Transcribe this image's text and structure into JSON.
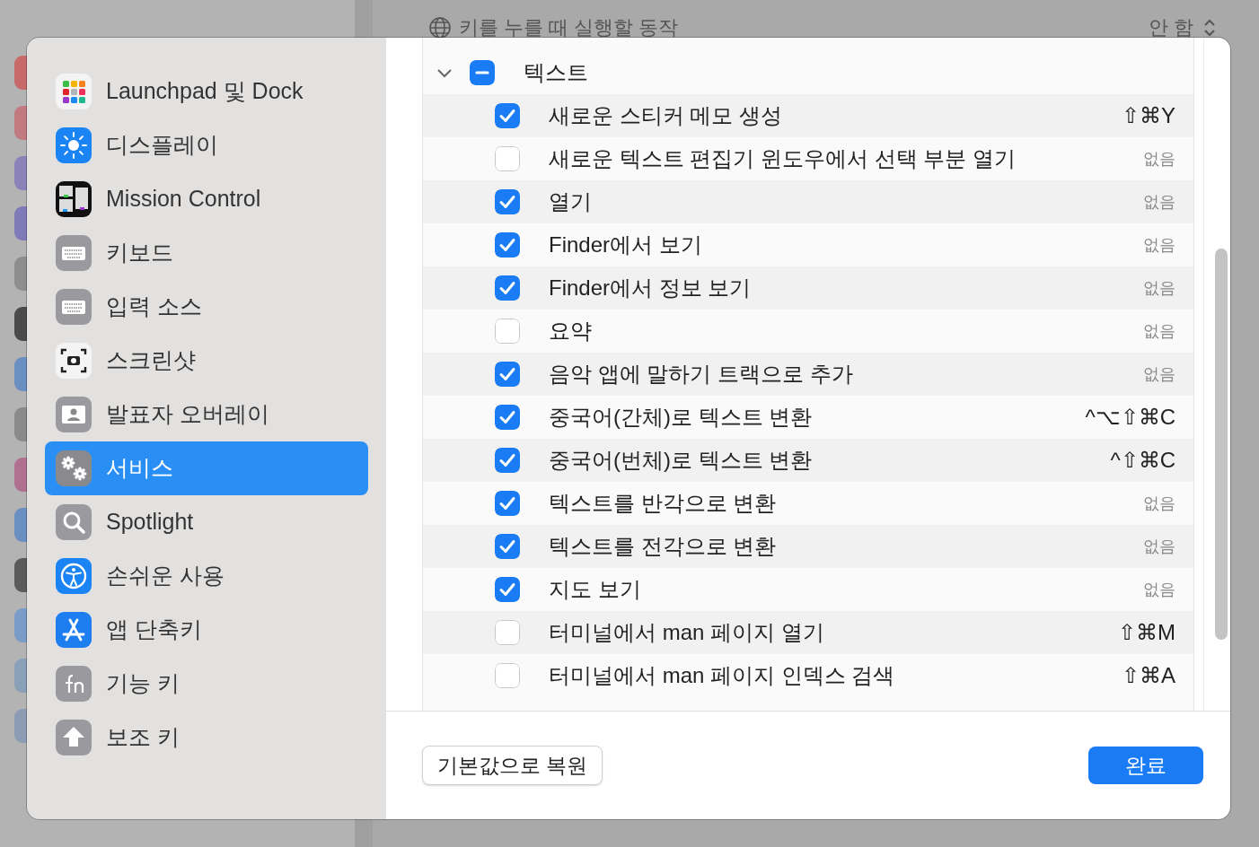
{
  "background": {
    "setting_label": "키를 누를 때 실행할 동작",
    "setting_value": "안 함"
  },
  "sidebar": {
    "items": [
      {
        "label": "Launchpad 및 Dock",
        "kind": "launchpad",
        "selected": false
      },
      {
        "label": "디스플레이",
        "kind": "display",
        "selected": false
      },
      {
        "label": "Mission Control",
        "kind": "mission",
        "selected": false
      },
      {
        "label": "키보드",
        "kind": "keyboard",
        "selected": false
      },
      {
        "label": "입력 소스",
        "kind": "keyboard",
        "selected": false
      },
      {
        "label": "스크린샷",
        "kind": "screenshot",
        "selected": false
      },
      {
        "label": "발표자 오버레이",
        "kind": "presenter",
        "selected": false
      },
      {
        "label": "서비스",
        "kind": "services",
        "selected": true
      },
      {
        "label": "Spotlight",
        "kind": "spotlight",
        "selected": false
      },
      {
        "label": "손쉬운 사용",
        "kind": "accessibility",
        "selected": false
      },
      {
        "label": "앱 단축키",
        "kind": "appstore",
        "selected": false
      },
      {
        "label": "기능 키",
        "kind": "fn",
        "selected": false
      },
      {
        "label": "보조 키",
        "kind": "modifier",
        "selected": false
      }
    ]
  },
  "services": {
    "group": {
      "label": "텍스트",
      "expanded": true,
      "mixed": true
    },
    "items": [
      {
        "label": "새로운 스티커 메모 생성",
        "checked": true,
        "shortcut": "⇧⌘Y",
        "assigned": true
      },
      {
        "label": "새로운 텍스트 편집기 윈도우에서 선택 부분 열기",
        "checked": false,
        "shortcut": "없음",
        "assigned": false
      },
      {
        "label": "열기",
        "checked": true,
        "shortcut": "없음",
        "assigned": false
      },
      {
        "label": "Finder에서 보기",
        "checked": true,
        "shortcut": "없음",
        "assigned": false
      },
      {
        "label": "Finder에서 정보 보기",
        "checked": true,
        "shortcut": "없음",
        "assigned": false
      },
      {
        "label": "요약",
        "checked": false,
        "shortcut": "없음",
        "assigned": false
      },
      {
        "label": "음악 앱에 말하기 트랙으로 추가",
        "checked": true,
        "shortcut": "없음",
        "assigned": false
      },
      {
        "label": "중국어(간체)로 텍스트 변환",
        "checked": true,
        "shortcut": "^⌥⇧⌘C",
        "assigned": true
      },
      {
        "label": "중국어(번체)로 텍스트 변환",
        "checked": true,
        "shortcut": "^⇧⌘C",
        "assigned": true
      },
      {
        "label": "텍스트를 반각으로 변환",
        "checked": true,
        "shortcut": "없음",
        "assigned": false
      },
      {
        "label": "텍스트를 전각으로 변환",
        "checked": true,
        "shortcut": "없음",
        "assigned": false
      },
      {
        "label": "지도 보기",
        "checked": true,
        "shortcut": "없음",
        "assigned": false
      },
      {
        "label": "터미널에서 man 페이지 열기",
        "checked": false,
        "shortcut": "⇧⌘M",
        "assigned": true
      },
      {
        "label": "터미널에서 man 페이지 인덱스 검색",
        "checked": false,
        "shortcut": "⇧⌘A",
        "assigned": true
      }
    ]
  },
  "buttons": {
    "restore": "기본값으로 복원",
    "done": "완료"
  }
}
